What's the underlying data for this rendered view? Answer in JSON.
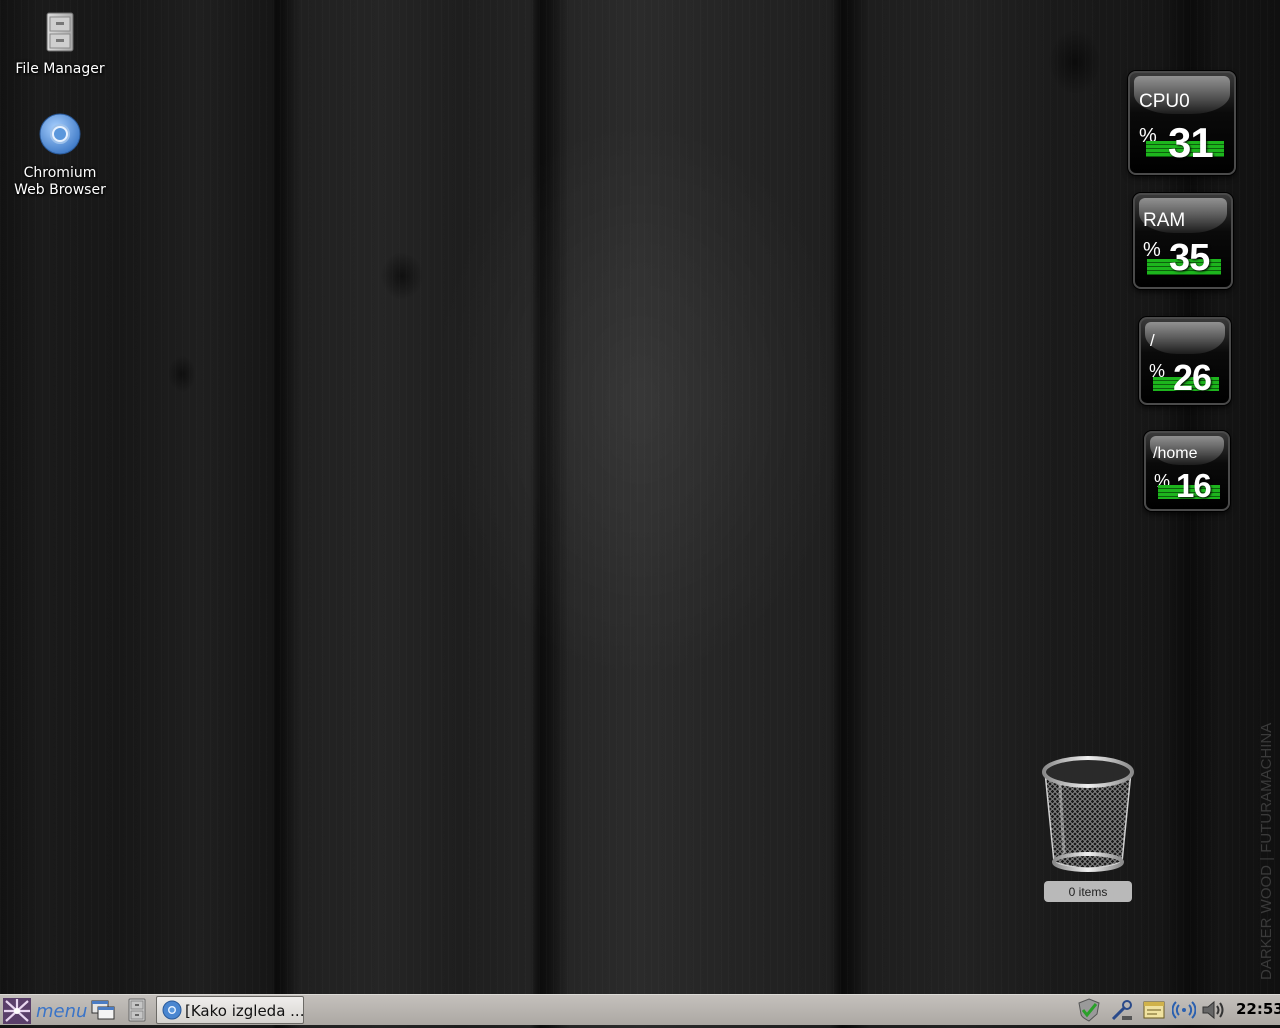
{
  "desktop": {
    "icons": [
      {
        "label": "File Manager",
        "icon": "file-cabinet-icon"
      },
      {
        "label_line1": "Chromium",
        "label_line2": "Web Browser",
        "icon": "chromium-icon"
      }
    ],
    "watermark": "DARKER WOOD | FUTURAMACHINA"
  },
  "gauges": [
    {
      "name": "CPU0",
      "unit": "%",
      "value": "31"
    },
    {
      "name": "RAM",
      "unit": "%",
      "value": "35"
    },
    {
      "name": "/",
      "unit": "%",
      "value": "26"
    },
    {
      "name": "/home",
      "unit": "%",
      "value": "16"
    }
  ],
  "trash": {
    "label": "0 items",
    "icon": "trash-bin-icon"
  },
  "taskbar": {
    "menu_label": "menu",
    "task_label": "[Kako izgleda ...",
    "clock": "22:53",
    "tray_icons": [
      "shield-check-icon",
      "network-tool-icon",
      "notes-icon",
      "wireless-icon",
      "volume-icon"
    ]
  },
  "colors": {
    "accent_green": "#1db51d",
    "menu_blue": "#3a74c8",
    "taskbar": "#b8b4af"
  }
}
